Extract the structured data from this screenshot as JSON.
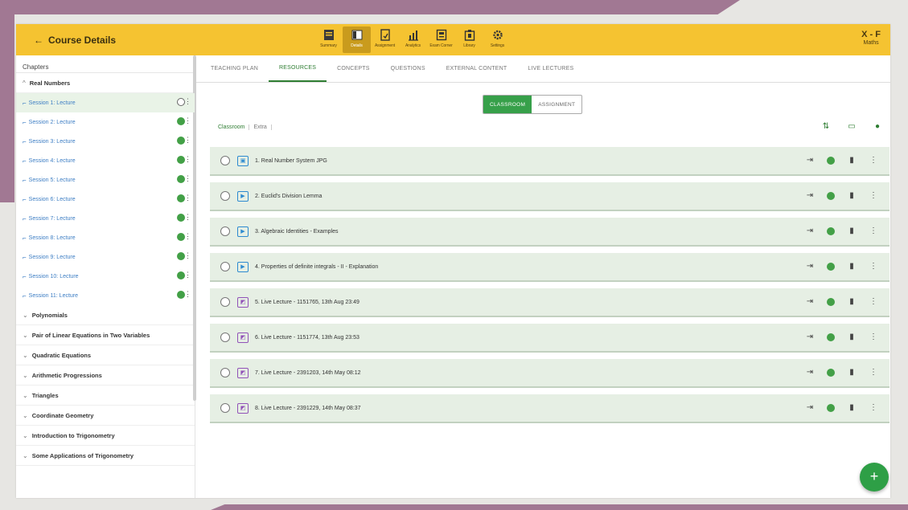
{
  "header": {
    "back_label": "Course Details",
    "class_name": "X - F",
    "subject": "Maths"
  },
  "nav": [
    {
      "label": "Summary",
      "icon": "summary-icon"
    },
    {
      "label": "Details",
      "icon": "details-icon"
    },
    {
      "label": "Assignment",
      "icon": "assignment-icon"
    },
    {
      "label": "Analytics",
      "icon": "analytics-icon"
    },
    {
      "label": "Exam Corner",
      "icon": "exam-corner-icon"
    },
    {
      "label": "Library",
      "icon": "library-icon"
    },
    {
      "label": "Settings",
      "icon": "settings-icon"
    }
  ],
  "sidebar": {
    "header": "Chapters",
    "chapters": [
      {
        "title": "Real Numbers"
      },
      {
        "title": "Polynomials"
      },
      {
        "title": "Pair of Linear Equations in Two Variables"
      },
      {
        "title": "Quadratic Equations"
      },
      {
        "title": "Arithmetic Progressions"
      },
      {
        "title": "Triangles"
      },
      {
        "title": "Coordinate Geometry"
      },
      {
        "title": "Introduction to Trigonometry"
      },
      {
        "title": "Some Applications of Trigonometry"
      }
    ],
    "sessions": [
      "Session 1: Lecture",
      "Session 2: Lecture",
      "Session 3: Lecture",
      "Session 4: Lecture",
      "Session 5: Lecture",
      "Session 6: Lecture",
      "Session 7: Lecture",
      "Session 8: Lecture",
      "Session 9: Lecture",
      "Session 10: Lecture",
      "Session 11: Lecture"
    ]
  },
  "tabs": [
    "TEACHING PLAN",
    "RESOURCES",
    "CONCEPTS",
    "QUESTIONS",
    "EXTERNAL CONTENT",
    "LIVE LECTURES"
  ],
  "toggle": {
    "classroom": "CLASSROOM",
    "assignment": "ASSIGNMENT"
  },
  "subtabs": [
    "Classroom",
    "Extra"
  ],
  "resources": [
    "1. Real Number System JPG",
    "2. Euclid's Division Lemma",
    "3. Algebraic Identities - Examples",
    "4. Properties of definite integrals - II - Explanation",
    "5. Live Lecture - 1151765, 13th Aug 23:49",
    "6. Live Lecture - 1151774, 13th Aug 23:53",
    "7. Live Lecture - 2391203, 14th May 08:12",
    "8. Live Lecture - 2391229, 14th May 08:37"
  ],
  "fab_label": "+",
  "colors": {
    "accent": "#f5c331",
    "green": "#2e7d32",
    "row_bg": "#e6efe4",
    "frame": "#a17893"
  }
}
